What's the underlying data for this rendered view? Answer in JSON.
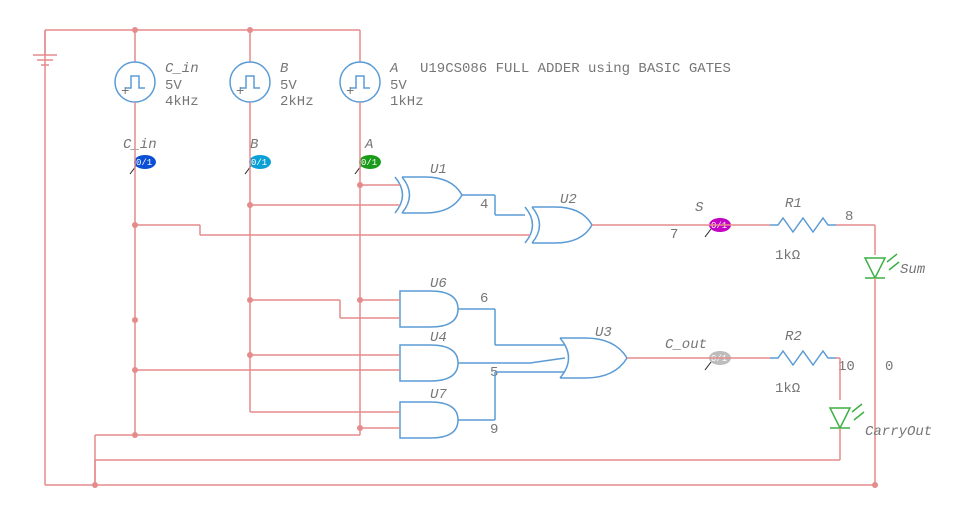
{
  "header": {
    "title": "U19CS086 FULL ADDER using BASIC GATES"
  },
  "sources": {
    "c_in": {
      "label": "C_in",
      "voltage": "5V",
      "freq": "4kHz"
    },
    "b": {
      "label": "B",
      "voltage": "5V",
      "freq": "2kHz"
    },
    "a": {
      "label": "A",
      "voltage": "5V",
      "freq": "1kHz"
    }
  },
  "gates": {
    "u1": "U1",
    "u2": "U2",
    "u3": "U3",
    "u4": "U4",
    "u6": "U6",
    "u7": "U7"
  },
  "resistors": {
    "r1": {
      "name": "R1",
      "value": "1kΩ"
    },
    "r2": {
      "name": "R2",
      "value": "1kΩ"
    }
  },
  "leds": {
    "sum": "Sum",
    "cout": "CarryOut"
  },
  "probes": {
    "c_in": {
      "label": "C_in",
      "symbol": "0/1"
    },
    "b": {
      "label": "B",
      "symbol": "0/1"
    },
    "a": {
      "label": "A",
      "symbol": "0/1"
    },
    "s": {
      "label": "S",
      "symbol": "0/1"
    },
    "cout": {
      "label": "C_out",
      "symbol": "0/1"
    }
  },
  "nets": {
    "n4": "4",
    "n5": "5",
    "n6": "6",
    "n7": "7",
    "n8": "8",
    "n9": "9",
    "n10": "10",
    "n0": "0"
  },
  "chart_data": {
    "type": "schematic",
    "circuit": "Full Adder",
    "inputs": [
      "A",
      "B",
      "C_in"
    ],
    "outputs": [
      "Sum",
      "CarryOut"
    ],
    "gates": [
      {
        "id": "U1",
        "type": "XOR",
        "inputs": [
          "A",
          "B"
        ],
        "output": "net4"
      },
      {
        "id": "U2",
        "type": "XOR",
        "inputs": [
          "net4",
          "C_in"
        ],
        "output": "S (net7)"
      },
      {
        "id": "U6",
        "type": "AND",
        "inputs": [
          "A",
          "B"
        ],
        "output": "net6"
      },
      {
        "id": "U4",
        "type": "AND",
        "inputs": [
          "B",
          "C_in"
        ],
        "output": "net5"
      },
      {
        "id": "U7",
        "type": "AND",
        "inputs": [
          "A",
          "C_in"
        ],
        "output": "net9"
      },
      {
        "id": "U3",
        "type": "OR3",
        "inputs": [
          "net6",
          "net5",
          "net9"
        ],
        "output": "C_out"
      }
    ],
    "sources": [
      {
        "name": "A",
        "amplitude_v": 5,
        "freq_khz": 1
      },
      {
        "name": "B",
        "amplitude_v": 5,
        "freq_khz": 2
      },
      {
        "name": "C_in",
        "amplitude_v": 5,
        "freq_khz": 4
      }
    ],
    "resistors": [
      {
        "name": "R1",
        "ohms": 1000,
        "net_from": "S",
        "net_to": "8"
      },
      {
        "name": "R2",
        "ohms": 1000,
        "net_from": "C_out",
        "net_to": "10"
      }
    ],
    "indicators": [
      {
        "name": "Sum",
        "type": "LED",
        "anode_net": "8",
        "cathode_net": "0"
      },
      {
        "name": "CarryOut",
        "type": "LED",
        "anode_net": "10",
        "cathode_net": "0"
      }
    ],
    "ground_net": "0"
  }
}
